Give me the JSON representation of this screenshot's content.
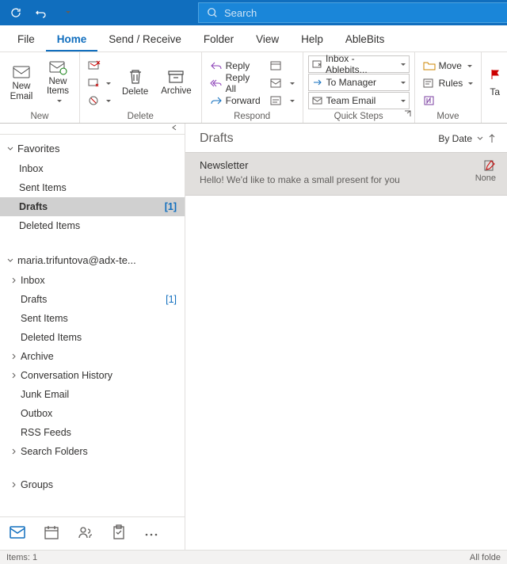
{
  "search": {
    "placeholder": "Search"
  },
  "menus": {
    "file": "File",
    "home": "Home",
    "sendreceive": "Send / Receive",
    "folder": "Folder",
    "view": "View",
    "help": "Help",
    "ablebits": "AbleBits"
  },
  "ribbon": {
    "new": {
      "label": "New",
      "new_email": "New\nEmail",
      "new_items": "New\nItems"
    },
    "delete": {
      "label": "Delete",
      "delete_btn": "Delete",
      "archive_btn": "Archive"
    },
    "respond": {
      "label": "Respond",
      "reply": "Reply",
      "reply_all": "Reply All",
      "forward": "Forward"
    },
    "quicksteps": {
      "label": "Quick Steps",
      "inbox_ablebits": "Inbox - Ablebits...",
      "to_manager": "To Manager",
      "team_email": "Team Email"
    },
    "move": {
      "label": "Move",
      "move_btn": "Move",
      "rules_btn": "Rules"
    },
    "tags": {
      "tag_btn": "Ta"
    }
  },
  "nav": {
    "favorites": {
      "label": "Favorites",
      "inbox": "Inbox",
      "sent": "Sent Items",
      "drafts": "Drafts",
      "drafts_count": "[1]",
      "deleted": "Deleted Items"
    },
    "account": {
      "label": "maria.trifuntova@adx-te...",
      "inbox": "Inbox",
      "drafts": "Drafts",
      "drafts_count": "[1]",
      "sent": "Sent Items",
      "deleted": "Deleted Items",
      "archive": "Archive",
      "conv": "Conversation History",
      "junk": "Junk Email",
      "outbox": "Outbox",
      "rss": "RSS Feeds",
      "search_folders": "Search Folders"
    },
    "groups": "Groups"
  },
  "content": {
    "folder_title": "Drafts",
    "sort_label": "By Date",
    "msg": {
      "subject": "Newsletter",
      "preview": "Hello!  We'd like to make a small present for you",
      "category": "None"
    }
  },
  "status": {
    "left": "Items: 1",
    "right": "All folde"
  }
}
